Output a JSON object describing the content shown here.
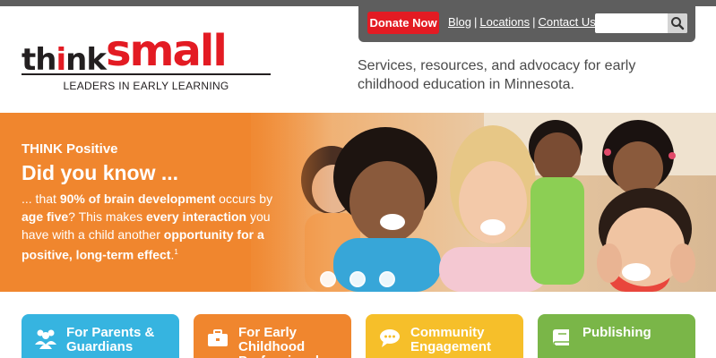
{
  "logo": {
    "word_think_a": "th",
    "word_think_i": "i",
    "word_think_b": "nk",
    "word_small": "small",
    "tagline": "LEADERS IN EARLY LEARNING"
  },
  "utility": {
    "donate_label": "Donate Now",
    "links": [
      "Blog",
      "Locations",
      "Contact Us"
    ],
    "search_placeholder": "",
    "search_icon": "search-icon"
  },
  "header": {
    "tagline": "Services, resources, and advocacy for early childhood education in Minnesota."
  },
  "hero": {
    "kicker": "THINK Positive",
    "title": "Did you know ...",
    "body_parts": [
      "... that ",
      "90% of brain development",
      " occurs by ",
      "age five",
      "? This makes ",
      "every interaction",
      " you have with a child another ",
      "opportunity for a positive, long-term effect",
      ".",
      "1"
    ],
    "slides": 3,
    "active_slide": 1
  },
  "tiles": [
    {
      "label": "For Parents & Guardians",
      "icon": "people-icon",
      "color": "#36b4e0"
    },
    {
      "label": "For Early Childhood Professionals",
      "icon": "briefcase-icon",
      "color": "#f0862e"
    },
    {
      "label": "Community Engagement",
      "icon": "speech-bubble-icon",
      "color": "#f6bf2a"
    },
    {
      "label": "Publishing",
      "icon": "book-icon",
      "color": "#7ab648"
    }
  ],
  "colors": {
    "brand_red": "#e31b23",
    "header_gray": "#5e5e5e",
    "hero_orange": "#f0862e"
  }
}
